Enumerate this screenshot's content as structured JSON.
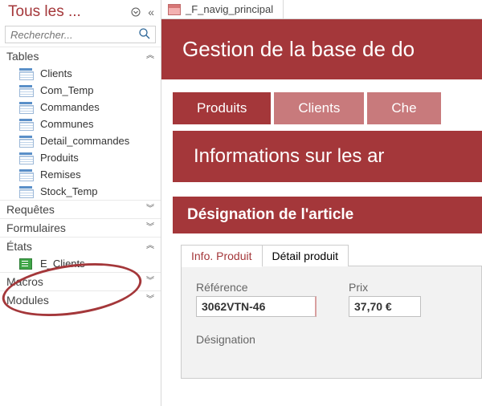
{
  "nav": {
    "title": "Tous les ...",
    "search_placeholder": "Rechercher...",
    "groups": {
      "tables": {
        "label": "Tables",
        "items": [
          "Clients",
          "Com_Temp",
          "Commandes",
          "Communes",
          "Detail_commandes",
          "Produits",
          "Remises",
          "Stock_Temp"
        ]
      },
      "requetes": {
        "label": "Requêtes"
      },
      "formulaires": {
        "label": "Formulaires"
      },
      "etats": {
        "label": "États",
        "items": [
          "E_Clients"
        ]
      },
      "macros": {
        "label": "Macros"
      },
      "modules": {
        "label": "Modules"
      }
    }
  },
  "doc": {
    "tab_label": "_F_navig_principal"
  },
  "form": {
    "header_title": "Gestion de la base de do",
    "tabs": [
      "Produits",
      "Clients",
      "Che"
    ],
    "section_info": "Informations sur les ar",
    "section_desig": "Désignation de l'article",
    "inner_tabs": [
      "Info. Produit",
      "Détail produit"
    ],
    "fields": {
      "ref_label": "Référence",
      "ref_value": "3062VTN-46",
      "prix_label": "Prix",
      "prix_value": "37,70 €",
      "desig_label": "Désignation"
    }
  }
}
